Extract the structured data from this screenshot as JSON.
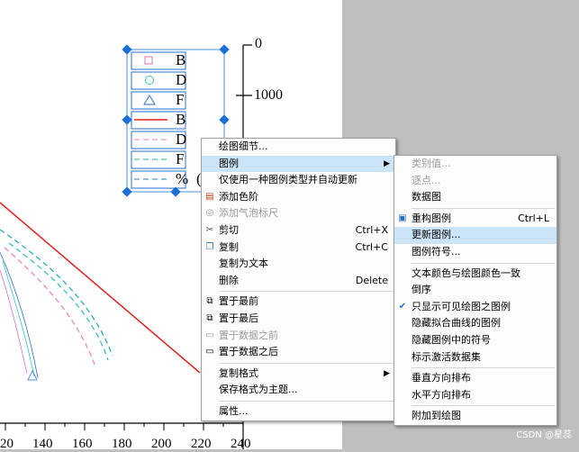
{
  "plot": {
    "y_ticks": [
      "0",
      "1000"
    ],
    "x_ticks": [
      "20",
      "140",
      "160",
      "180",
      "200",
      "220",
      "240"
    ],
    "legend_labels": [
      "B",
      "D",
      "F",
      "B",
      "D",
      "F",
      "%",
      "("
    ]
  },
  "menu_main": {
    "items": [
      {
        "label": "绘图细节...",
        "icon": "",
        "shortcut": "",
        "disabled": false,
        "submenu": false,
        "highlight": false
      },
      {
        "label": "图例",
        "icon": "",
        "shortcut": "",
        "disabled": false,
        "submenu": true,
        "highlight": true
      },
      {
        "label": "仅使用一种图例类型并自动更新",
        "icon": "",
        "shortcut": "",
        "disabled": false,
        "submenu": false,
        "highlight": false
      },
      {
        "label": "添加色阶",
        "icon": "color-scale-icon",
        "shortcut": "",
        "disabled": false,
        "submenu": false,
        "highlight": false
      },
      {
        "label": "添加气泡标尺",
        "icon": "bubble-scale-icon",
        "shortcut": "",
        "disabled": true,
        "submenu": false,
        "highlight": false
      },
      {
        "label": "剪切",
        "icon": "cut-icon",
        "shortcut": "Ctrl+X",
        "disabled": false,
        "submenu": false,
        "highlight": false
      },
      {
        "label": "复制",
        "icon": "copy-icon",
        "shortcut": "Ctrl+C",
        "disabled": false,
        "submenu": false,
        "highlight": false
      },
      {
        "label": "复制为文本",
        "icon": "",
        "shortcut": "",
        "disabled": false,
        "submenu": false,
        "highlight": false
      },
      {
        "label": "删除",
        "icon": "",
        "shortcut": "Delete",
        "disabled": false,
        "submenu": false,
        "highlight": false
      },
      {
        "sep": true
      },
      {
        "label": "置于最前",
        "icon": "bring-front-icon",
        "shortcut": "",
        "disabled": false,
        "submenu": false,
        "highlight": false
      },
      {
        "label": "置于最后",
        "icon": "send-back-icon",
        "shortcut": "",
        "disabled": false,
        "submenu": false,
        "highlight": false
      },
      {
        "label": "置于数据之前",
        "icon": "before-data-icon",
        "shortcut": "",
        "disabled": true,
        "submenu": false,
        "highlight": false
      },
      {
        "label": "置于数据之后",
        "icon": "after-data-icon",
        "shortcut": "",
        "disabled": false,
        "submenu": false,
        "highlight": false
      },
      {
        "sep": true
      },
      {
        "label": "复制格式",
        "icon": "",
        "shortcut": "",
        "disabled": false,
        "submenu": true,
        "highlight": false
      },
      {
        "label": "保存格式为主题...",
        "icon": "",
        "shortcut": "",
        "disabled": false,
        "submenu": false,
        "highlight": false
      },
      {
        "sep": true
      },
      {
        "label": "属性...",
        "icon": "",
        "shortcut": "",
        "disabled": false,
        "submenu": false,
        "highlight": false
      }
    ]
  },
  "menu_sub": {
    "items": [
      {
        "label": "类别值...",
        "icon": "",
        "shortcut": "",
        "disabled": true,
        "highlight": false
      },
      {
        "label": "逐点...",
        "icon": "",
        "shortcut": "",
        "disabled": true,
        "highlight": false
      },
      {
        "label": "数据图",
        "icon": "",
        "shortcut": "",
        "disabled": false,
        "highlight": false
      },
      {
        "sep": true
      },
      {
        "label": "重构图例",
        "icon": "legend-icon",
        "shortcut": "Ctrl+L",
        "disabled": false,
        "highlight": false
      },
      {
        "label": "更新图例...",
        "icon": "",
        "shortcut": "",
        "disabled": false,
        "highlight": true
      },
      {
        "label": "图例符号...",
        "icon": "",
        "shortcut": "",
        "disabled": false,
        "highlight": false
      },
      {
        "sep": true
      },
      {
        "label": "文本颜色与绘图颜色一致",
        "icon": "",
        "shortcut": "",
        "disabled": false,
        "highlight": false
      },
      {
        "label": "倒序",
        "icon": "",
        "shortcut": "",
        "disabled": false,
        "highlight": false
      },
      {
        "label": "只显示可见绘图之图例",
        "icon": "check-icon",
        "shortcut": "",
        "disabled": false,
        "highlight": false
      },
      {
        "label": "隐藏拟合曲线的图例",
        "icon": "",
        "shortcut": "",
        "disabled": false,
        "highlight": false
      },
      {
        "label": "隐藏图例中的符号",
        "icon": "",
        "shortcut": "",
        "disabled": false,
        "highlight": false
      },
      {
        "label": "标示激活数据集",
        "icon": "",
        "shortcut": "",
        "disabled": false,
        "highlight": false
      },
      {
        "sep": true
      },
      {
        "label": "垂直方向排布",
        "icon": "",
        "shortcut": "",
        "disabled": false,
        "highlight": false
      },
      {
        "label": "水平方向排布",
        "icon": "",
        "shortcut": "",
        "disabled": false,
        "highlight": false
      },
      {
        "sep": true
      },
      {
        "label": "附加到绘图",
        "icon": "",
        "shortcut": "",
        "disabled": false,
        "highlight": false
      }
    ]
  },
  "watermark": "CSDN @星蕊"
}
